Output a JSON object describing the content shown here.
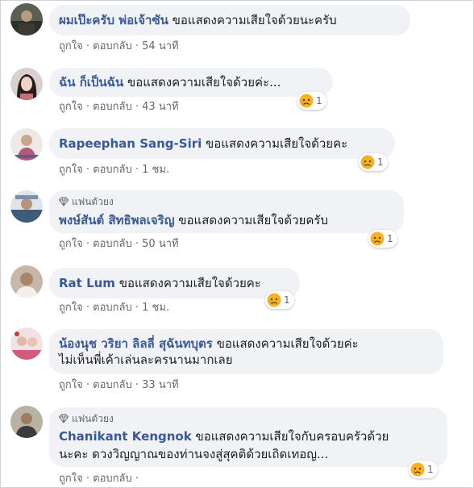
{
  "actions": {
    "like": "ถูกใจ",
    "reply": "ตอบกลับ",
    "sep": "·"
  },
  "fan_badge": "แฟนตัวยง",
  "comments": [
    {
      "name": "ผมเป๊ะครับ พ่อเจ้าซัน",
      "text": [
        "ขอแสดงความเสียใจด้วยนะครับ"
      ],
      "time": "54 นาที",
      "reactions": null
    },
    {
      "name": "ฉัน ก็เป็นฉัน",
      "text": [
        "ขอแสดงความเสียใจด้วยค่ะ..."
      ],
      "time": "43 นาที",
      "reactions": "1"
    },
    {
      "name": "Rapeephan Sang-Siri",
      "text": [
        "ขอแสดงความเสียใจด้วยคะ"
      ],
      "time": "1 ชม.",
      "reactions": "1"
    },
    {
      "name": "พงษ์สันต์ สิทธิพลเจริญ",
      "text": [
        "ขอแสดงความเสียใจด้วยครับ"
      ],
      "time": "50 นาที",
      "reactions": "1"
    },
    {
      "name": "Rat Lum",
      "text": [
        "ขอแสดงความเสียใจด้วยคะ"
      ],
      "time": "1 ชม.",
      "reactions": "1"
    },
    {
      "name": "น้องนุช วริยา ลิลลี่ สุฉันทบุตร",
      "text": [
        "ขอแสดงความเสียใจด้วยค่ะ",
        "ไม่เห็นพี่เค้าเล่นละครนานมากเลย"
      ],
      "time": "33 นาที",
      "reactions": null
    },
    {
      "name": "Chanikant Kengnok",
      "text": [
        "ขอแสดงความเสียใจกับครอบครัวด้วย",
        "นะคะ ดวงวิญญาณของท่านจงสู่สุคติด้วยเถิดเทอญ..."
      ],
      "time": "",
      "reactions": "1"
    }
  ],
  "colors": {
    "name": "#385898",
    "bubble": "#f0f2f5",
    "meta": "#65676b",
    "sad": "#f7b125"
  }
}
